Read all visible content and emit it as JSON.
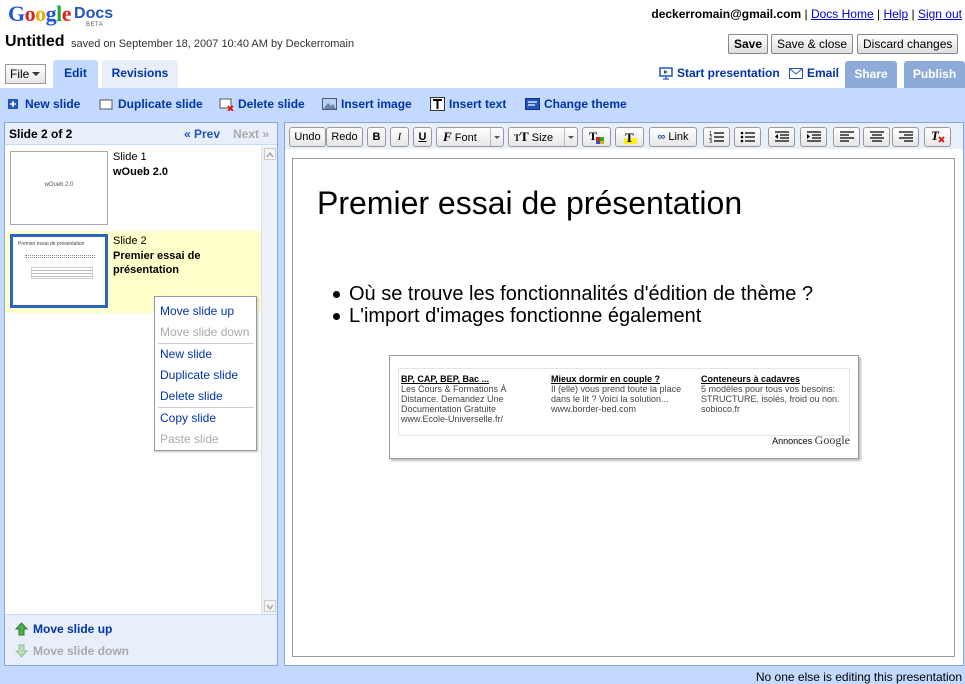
{
  "header": {
    "logo_google": "Google",
    "logo_docs": "Docs",
    "logo_beta": "BETA",
    "user_email": "deckerromain@gmail.com",
    "links": {
      "docs_home": "Docs Home",
      "help": "Help",
      "sign_out": "Sign out"
    },
    "sep": "|"
  },
  "document": {
    "title": "Untitled",
    "meta": "saved on September 18, 2007 10:40 AM by Deckerromain"
  },
  "actions": {
    "save": "Save",
    "save_close": "Save & close",
    "discard": "Discard changes"
  },
  "tabs": {
    "file": "File",
    "edit": "Edit",
    "revisions": "Revisions"
  },
  "right_actions": {
    "start_presentation": "Start presentation",
    "email": "Email",
    "share": "Share",
    "publish": "Publish"
  },
  "slide_toolbar": {
    "new_slide": "New slide",
    "duplicate_slide": "Duplicate slide",
    "delete_slide": "Delete slide",
    "insert_image": "Insert image",
    "insert_text": "Insert text",
    "change_theme": "Change theme"
  },
  "slides_panel": {
    "heading": "Slide 2 of 2",
    "prev": "« Prev",
    "next": "Next »",
    "slides": [
      {
        "number": "Slide 1",
        "title": "wOueb 2.0",
        "thumb_text": "wOueb 2.0"
      },
      {
        "number": "Slide 2",
        "title": "Premier essai de présentation",
        "thumb_text": "Premier essai de présentation"
      }
    ],
    "footer": {
      "move_up": "Move slide up",
      "move_down": "Move slide down"
    }
  },
  "context_menu": {
    "move_up": "Move slide up",
    "move_down": "Move slide down",
    "new_slide": "New slide",
    "duplicate_slide": "Duplicate slide",
    "delete_slide": "Delete slide",
    "copy_slide": "Copy slide",
    "paste_slide": "Paste slide"
  },
  "format_toolbar": {
    "undo": "Undo",
    "redo": "Redo",
    "bold": "B",
    "italic": "I",
    "underline": "U",
    "font": "Font",
    "size": "Size",
    "link": "Link"
  },
  "slide": {
    "title": "Premier essai de présentation",
    "bullets": [
      "Où se trouve les fonctionnalités d'édition de thème ?",
      "L'import d'images fonctionne également"
    ]
  },
  "ads": {
    "columns": [
      {
        "heading": "BP, CAP, BEP, Bac ...",
        "body": "Les Cours & Formations À Distance. Demandez Une Documentation Gratuite",
        "url": "www.Ecole-Universelle.fr/"
      },
      {
        "heading": "Mieux dormir en couple ?",
        "body": "Il (elle) vous prend toute la place dans le lit ? Voici la solution...",
        "url": "www.border-bed.com"
      },
      {
        "heading": "Conteneurs à cadavres",
        "body": "5 modèles pour tous vos besoins: STRUCTURE, isolés, froid ou non.",
        "url": "sobioco.fr"
      }
    ],
    "brand_label": "Annonces",
    "brand_google": "Google"
  },
  "status": "No one else is editing this presentation",
  "colors": {
    "accent": "#0033aa",
    "panel_bg": "#c3d9ff",
    "share_btn": "#8eaad9",
    "selected_slide": "#ffffcc"
  }
}
